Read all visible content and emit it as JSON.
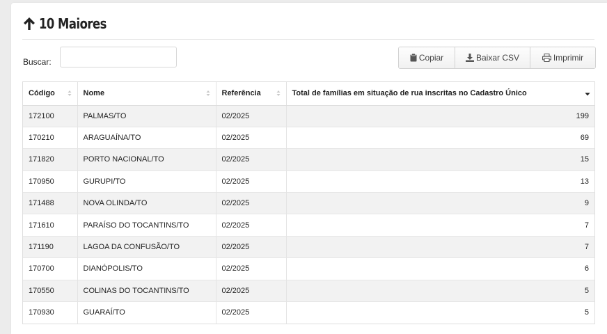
{
  "header": {
    "title": "10 Maiores",
    "title_icon": "arrow-up-icon"
  },
  "search": {
    "label": "Buscar:",
    "value": "",
    "placeholder": ""
  },
  "toolbar": {
    "copy_label": "Copiar",
    "csv_label": "Baixar CSV",
    "print_label": "Imprimir"
  },
  "table": {
    "columns": [
      "Código",
      "Nome",
      "Referência",
      "Total de famílias em situação de rua inscritas no Cadastro Único"
    ],
    "rows": [
      [
        "172100",
        "PALMAS/TO",
        "02/2025",
        "199"
      ],
      [
        "170210",
        "ARAGUAÍNA/TO",
        "02/2025",
        "69"
      ],
      [
        "171820",
        "PORTO NACIONAL/TO",
        "02/2025",
        "15"
      ],
      [
        "170950",
        "GURUPI/TO",
        "02/2025",
        "13"
      ],
      [
        "171488",
        "NOVA OLINDA/TO",
        "02/2025",
        "9"
      ],
      [
        "171610",
        "PARAÍSO DO TOCANTINS/TO",
        "02/2025",
        "7"
      ],
      [
        "171190",
        "LAGOA DA CONFUSÃO/TO",
        "02/2025",
        "7"
      ],
      [
        "170700",
        "DIANÓPOLIS/TO",
        "02/2025",
        "6"
      ],
      [
        "170550",
        "COLINAS DO TOCANTINS/TO",
        "02/2025",
        "5"
      ],
      [
        "170930",
        "GUARAÍ/TO",
        "02/2025",
        "5"
      ]
    ]
  },
  "colors": {
    "stripe": "#f2f2f2",
    "border": "#dedede",
    "text": "#222222"
  }
}
